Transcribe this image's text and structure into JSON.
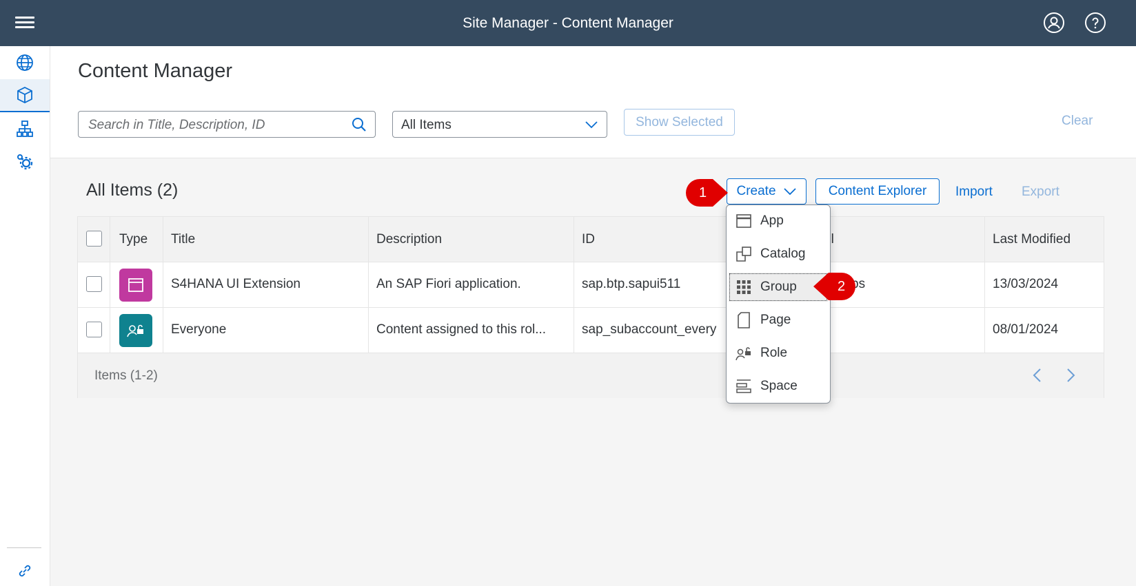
{
  "shell": {
    "title": "Site Manager - Content Manager",
    "menu_icon": "hamburger-icon",
    "profile_icon": "user-icon",
    "help_icon": "help-icon"
  },
  "sidenav": {
    "items": [
      {
        "icon": "globe-icon",
        "label": "Site Directory"
      },
      {
        "icon": "box-icon",
        "label": "Content Manager",
        "active": true
      },
      {
        "icon": "hierarchy-icon",
        "label": "Channel Manager"
      },
      {
        "icon": "settings-icon",
        "label": "Settings"
      }
    ],
    "bottom_icon": "link-icon"
  },
  "page": {
    "title": "Content Manager",
    "search_placeholder": "Search in Title, Description, ID",
    "filter_value": "All Items",
    "show_selected_label": "Show Selected",
    "clear_label": "Clear"
  },
  "list": {
    "title": "All Items (2)",
    "create_label": "Create",
    "content_explorer_label": "Content Explorer",
    "import_label": "Import",
    "export_label": "Export",
    "columns": [
      "Type",
      "Title",
      "Description",
      "ID",
      "el",
      "Last Modified"
    ],
    "rows": [
      {
        "type_icon": "app-icon",
        "type_color": "#c0399f",
        "title": "S4HANA UI Extension",
        "description": "An SAP Fiori application.",
        "id": "sap.btp.sapui511",
        "label": "ps",
        "last_modified": "13/03/2024"
      },
      {
        "type_icon": "role-icon",
        "type_color": "#0f828f",
        "title": "Everyone",
        "description": "Content assigned to this rol...",
        "id": "sap_subaccount_every",
        "label": "",
        "last_modified": "08/01/2024"
      }
    ],
    "footer": "Items (1-2)"
  },
  "create_menu": {
    "items": [
      {
        "label": "App",
        "icon": "app-window-icon"
      },
      {
        "label": "Catalog",
        "icon": "catalog-icon"
      },
      {
        "label": "Group",
        "icon": "grid-icon",
        "focused": true
      },
      {
        "label": "Page",
        "icon": "page-icon"
      },
      {
        "label": "Role",
        "icon": "role-icon"
      },
      {
        "label": "Space",
        "icon": "space-icon"
      }
    ]
  },
  "annotations": {
    "step1": "1",
    "step2": "2",
    "color": "#e00000"
  }
}
